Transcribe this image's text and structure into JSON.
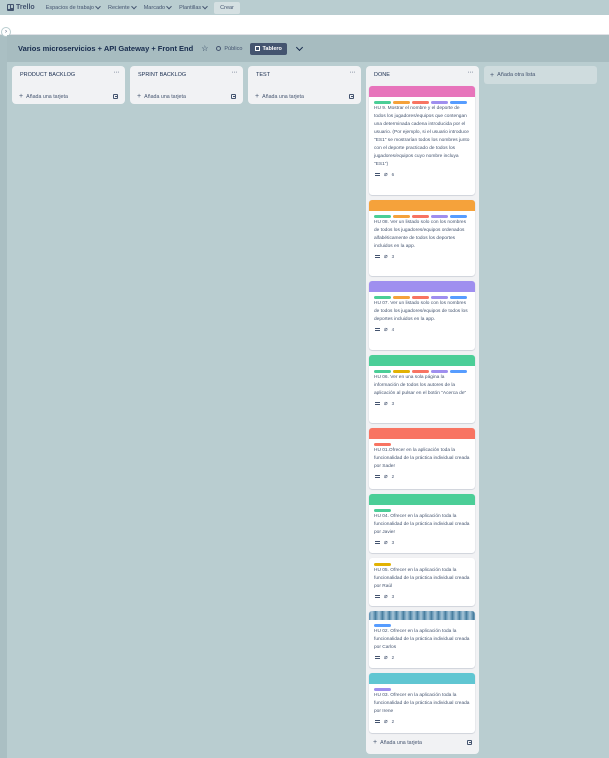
{
  "topbar": {
    "logo_text": "Trello",
    "nav": [
      "Espacios de trabajo",
      "Reciente",
      "Marcado",
      "Plantillas"
    ],
    "create_label": "Crear"
  },
  "board": {
    "title": "Varios microservicios + API Gateway + Front End",
    "visibility": "Público",
    "view_label": "Tablero"
  },
  "lists": [
    {
      "title": "PRODUCT BACKLOG",
      "add_card": "Añada una tarjeta"
    },
    {
      "title": "SPRINT BACKLOG",
      "add_card": "Añada una tarjeta"
    },
    {
      "title": "TEST",
      "add_card": "Añada una tarjeta"
    },
    {
      "title": "DONE",
      "add_card": "Añada una tarjeta"
    }
  ],
  "add_list_label": "Añada otra lista",
  "colors": {
    "green": "#4bce97",
    "yellow": "#e2b203",
    "orange": "#f5a23b",
    "red": "#f87462",
    "purple": "#9f8fef",
    "blue": "#579dff",
    "pink": "#e774bb",
    "teal": "#60c6d2"
  },
  "done_cards": [
    {
      "cover": "#e774bb",
      "labels": [
        "green",
        "orange",
        "red",
        "purple",
        "blue"
      ],
      "text": "HU 9. Mostrar el nombre y el deporte de todos los jugadores/equipos que contengan una determinada cadena introducida por el usuario. (Por ejemplo, si el usuario introduce \"ES1\" se mostrarían todos los nombres junto con el deporte practicado de todos los jugadores/equipos cuyo nombre incluya \"ES1\")",
      "attachments": "6"
    },
    {
      "cover": "#f5a23b",
      "labels": [
        "green",
        "orange",
        "red",
        "purple",
        "blue"
      ],
      "text": "HU 08. Ver un listado solo con los nombres de todos los jugadores/equipos ordenados alfabéticamente de todos los deportes incluidos en la app.",
      "attachments": "3"
    },
    {
      "cover": "#9f8fef",
      "labels": [
        "green",
        "orange",
        "red",
        "purple",
        "blue"
      ],
      "text": "HU 07. Ver un listado solo con los nombres de todos los jugadores/equipos de todos los deportes incluidos en la app.",
      "attachments": "4"
    },
    {
      "cover": "#4bce97",
      "labels": [
        "green",
        "yellow",
        "red",
        "purple",
        "blue"
      ],
      "text": "HU 06. Ver en una sola página la información de todos los autores de la aplicación al pulsar en el botón \"Acerca de\"",
      "attachments": "3"
    },
    {
      "cover": "#f87462",
      "labels": [
        "red"
      ],
      "text": "HU 01.Ofrecer en la aplicación toda la funcionalidad de la práctica individual creada por Sader",
      "attachments": "2"
    },
    {
      "cover": "#4bce97",
      "labels": [
        "green"
      ],
      "text": "HU 04. Ofrecer en la aplicación toda la funcionalidad de la práctica individual creada por Javier",
      "attachments": "3"
    },
    {
      "cover": "",
      "labels": [
        "yellow"
      ],
      "text": "HU 05. Ofrecer en la aplicación toda la funcionalidad de la práctica individual creada por Raúl",
      "attachments": "3"
    },
    {
      "cover": "image",
      "labels": [
        "blue"
      ],
      "text": "HU 02. Ofrecer en la aplicación toda la funcionalidad de la práctica individual creada por Carlos",
      "attachments": "2"
    },
    {
      "cover": "#60c6d2",
      "labels": [
        "purple"
      ],
      "text": "HU 03. Ofrecer en la aplicación toda la funcionalidad de la práctica individual creada por Irene",
      "attachments": "2"
    }
  ]
}
